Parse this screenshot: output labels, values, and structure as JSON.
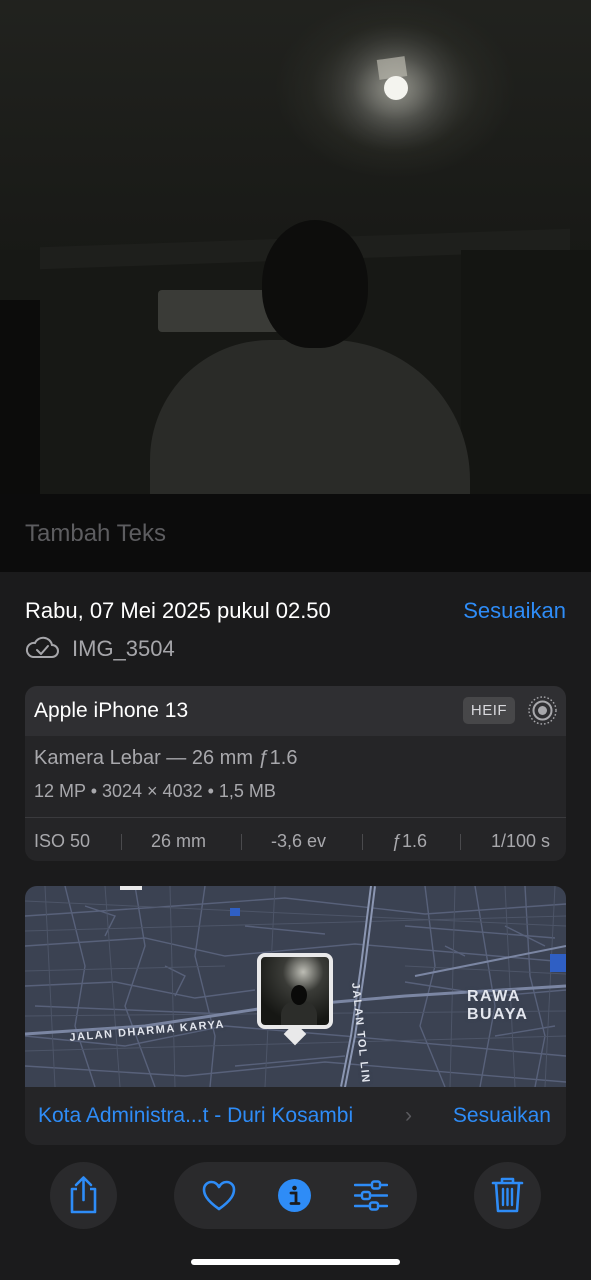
{
  "photo": {
    "alt_icon": "photo-thumbnail"
  },
  "caption": {
    "placeholder": "Tambah Teks"
  },
  "info": {
    "date_time": "Rabu, 07 Mei 2025 pukul 02.50",
    "adjust_label": "Sesuaikan",
    "filename": "IMG_3504"
  },
  "camera": {
    "model": "Apple iPhone 13",
    "format_badge": "HEIF",
    "lens": "Kamera Lebar — 26 mm ƒ1.6",
    "specs": "12 MP • 3024 × 4032 • 1,5 MB",
    "exif": [
      "ISO 50",
      "26 mm",
      "-3,6 ev",
      "ƒ1.6",
      "1/100 s"
    ]
  },
  "map": {
    "labels": {
      "area": "RAWA BUAYA",
      "road1": "JALAN DHARMA KARYA",
      "road2": "JALAN TOL LIN"
    },
    "location": "Kota Administra...t - Duri Kosambi",
    "chevron": "›",
    "adjust_label": "Sesuaikan"
  },
  "toolbar": {
    "share_icon": "share-icon",
    "favorite_icon": "heart-icon",
    "info_icon": "info-icon",
    "adjust_icon": "sliders-icon",
    "delete_icon": "trash-icon"
  },
  "colors": {
    "accent": "#2e8cf7",
    "panel": "#1b1b1c",
    "card": "#252527"
  }
}
